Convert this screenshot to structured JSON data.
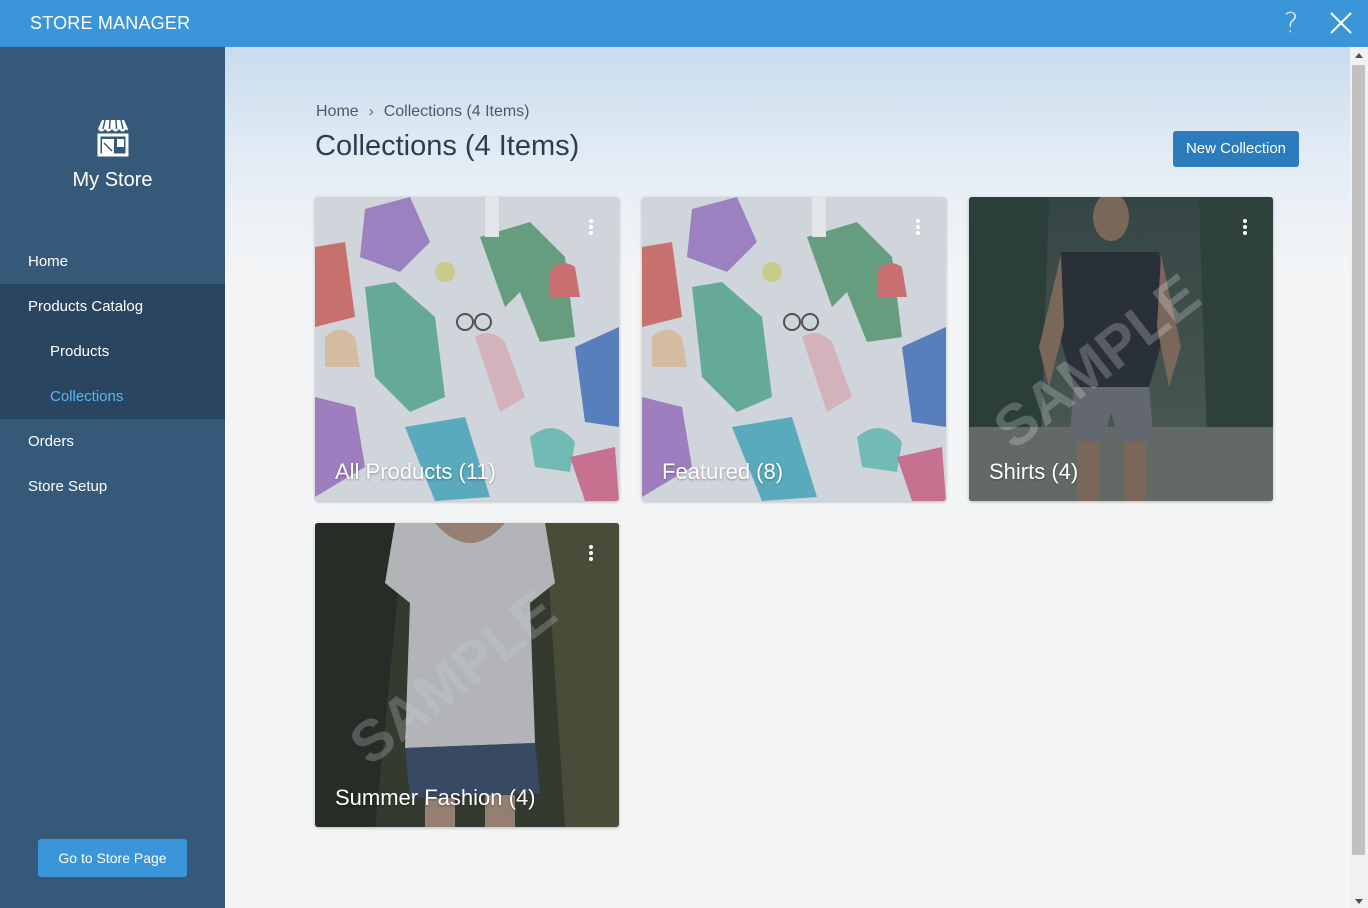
{
  "titlebar": {
    "title": "STORE MANAGER",
    "help_glyph": "?"
  },
  "sidebar": {
    "store_name": "My Store",
    "nav": {
      "home": "Home",
      "products_catalog": "Products Catalog",
      "products": "Products",
      "collections": "Collections",
      "orders": "Orders",
      "store_setup": "Store Setup"
    },
    "go_to_store": "Go to Store Page"
  },
  "main": {
    "breadcrumb": {
      "home": "Home",
      "separator": "›",
      "current": "Collections (4 Items)"
    },
    "title": "Collections (4 Items)",
    "new_collection": "New Collection",
    "collections": [
      {
        "label": "All Products (11)",
        "thumb": "clothing-flatlay"
      },
      {
        "label": "Featured (8)",
        "thumb": "clothing-flatlay"
      },
      {
        "label": "Shirts (4)",
        "thumb": "man-in-tshirt-sample"
      },
      {
        "label": "Summer Fashion (4)",
        "thumb": "woman-in-tshirt-sample"
      }
    ]
  },
  "colors": {
    "titlebar": "#3a95d9",
    "sidebar": "#36597a",
    "sidebar_group": "#2a4560",
    "active_link": "#5bb6f2",
    "primary_button": "#2b7bbd"
  }
}
